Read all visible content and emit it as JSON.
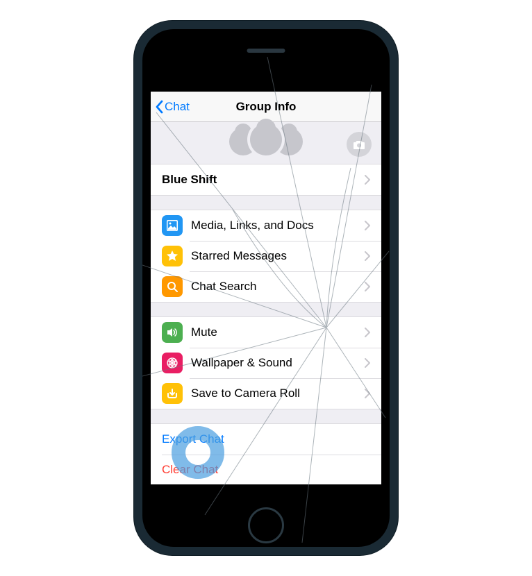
{
  "nav": {
    "back": "Chat",
    "title": "Group Info"
  },
  "group": {
    "name": "Blue Shift"
  },
  "section_media": [
    {
      "id": "media",
      "label": "Media, Links, and Docs"
    },
    {
      "id": "starred",
      "label": "Starred Messages"
    },
    {
      "id": "search",
      "label": "Chat Search"
    }
  ],
  "section_settings": [
    {
      "id": "mute",
      "label": "Mute"
    },
    {
      "id": "wallpaper",
      "label": "Wallpaper & Sound"
    },
    {
      "id": "camera_roll",
      "label": "Save to Camera Roll"
    }
  ],
  "actions": {
    "export": "Export Chat",
    "clear": "Clear Chat"
  }
}
